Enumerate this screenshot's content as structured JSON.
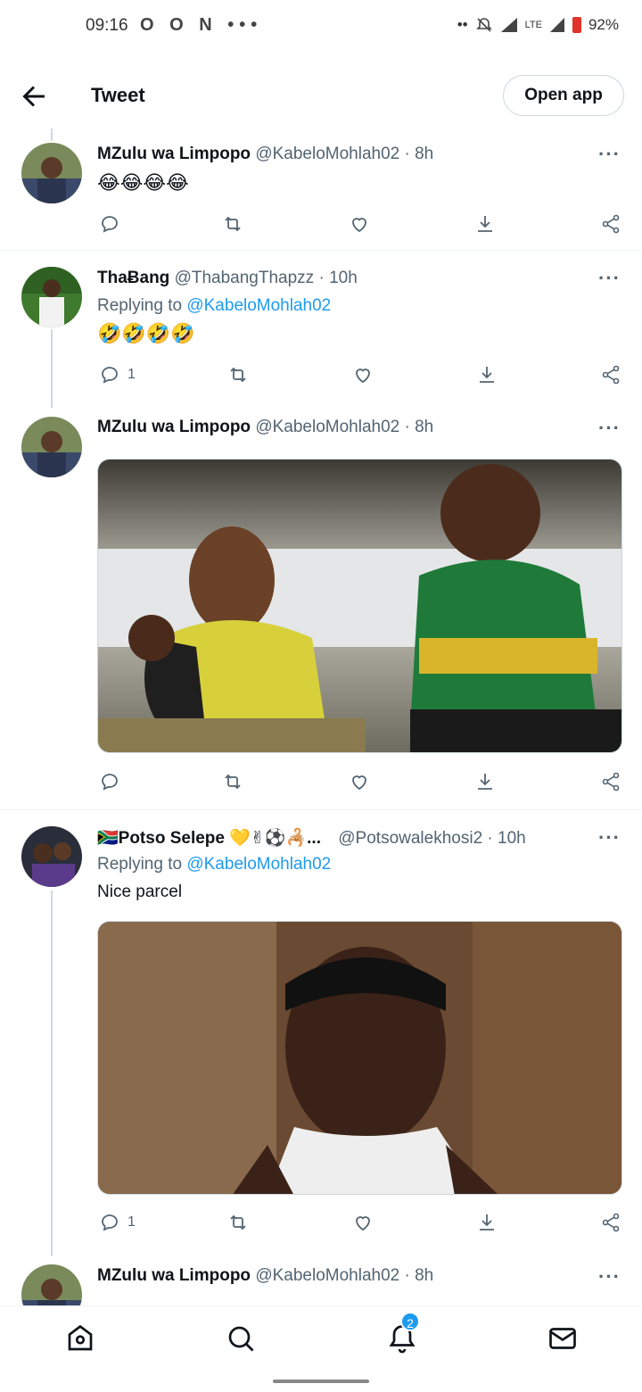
{
  "status_bar": {
    "time": "09:16",
    "left_icons": "O O N •••",
    "network": "LTE",
    "battery": "92%"
  },
  "header": {
    "title": "Tweet",
    "open_app_label": "Open app"
  },
  "tweets": [
    {
      "name": "MZulu wa Limpopo",
      "handle": "@KabeloMohlah02",
      "time": "8h",
      "text": "😂😂😂😂",
      "reply_count": ""
    },
    {
      "name": "ThaɃang",
      "handle": "@ThabangThapzz",
      "time": "10h",
      "replying_prefix": "Replying to",
      "replying_to": "@KabeloMohlah02",
      "text": "🤣🤣🤣🤣",
      "reply_count": "1"
    },
    {
      "name": "MZulu wa Limpopo",
      "handle": "@KabeloMohlah02",
      "time": "8h",
      "text": "",
      "reply_count": ""
    },
    {
      "name": "🇿🇦Potso Selepe 💛✌⚽🦂...",
      "handle": "@Potsowalekhosi2",
      "time": "10h",
      "replying_prefix": "Replying to",
      "replying_to": "@KabeloMohlah02",
      "text": "Nice parcel",
      "reply_count": "1"
    },
    {
      "name": "MZulu wa Limpopo",
      "handle": "@KabeloMohlah02",
      "time": "8h"
    }
  ],
  "nav": {
    "notifications_badge": "2"
  },
  "icons": [
    "back-arrow-icon",
    "reply-icon",
    "retweet-icon",
    "like-icon",
    "download-icon",
    "share-icon",
    "home-icon",
    "search-icon",
    "bell-icon",
    "mail-icon"
  ],
  "colors": {
    "accent": "#1d9bf0",
    "muted": "#536471",
    "text": "#0f1419"
  }
}
